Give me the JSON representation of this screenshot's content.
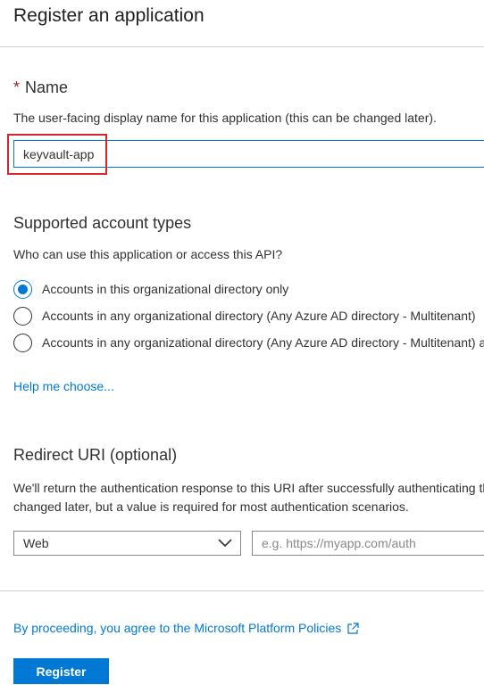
{
  "page": {
    "title": "Register an application"
  },
  "name_section": {
    "required_marker": "*",
    "heading": "Name",
    "description": "The user-facing display name for this application (this can be changed later).",
    "input_value": "keyvault-app"
  },
  "account_types": {
    "heading": "Supported account types",
    "question": "Who can use this application or access this API?",
    "options": [
      {
        "label": "Accounts in this organizational directory only",
        "selected": true
      },
      {
        "label": "Accounts in any organizational directory (Any Azure AD directory - Multitenant)",
        "selected": false
      },
      {
        "label": "Accounts in any organizational directory (Any Azure AD directory - Multitenant) and personal Microsoft accounts",
        "selected": false
      }
    ],
    "help_link": "Help me choose..."
  },
  "redirect": {
    "heading": "Redirect URI (optional)",
    "description_line1": "We'll return the authentication response to this URI after successfully authenticating the user. Providing this now is optional and it can be",
    "description_line2": "changed later, but a value is required for most authentication scenarios.",
    "platform_selected": "Web",
    "uri_placeholder": "e.g. https://myapp.com/auth"
  },
  "footer": {
    "policy_text": "By proceeding, you agree to the Microsoft Platform Policies",
    "register_label": "Register"
  },
  "colors": {
    "accent": "#0078d4",
    "required": "#a4262c",
    "annotation": "#d6262c"
  }
}
